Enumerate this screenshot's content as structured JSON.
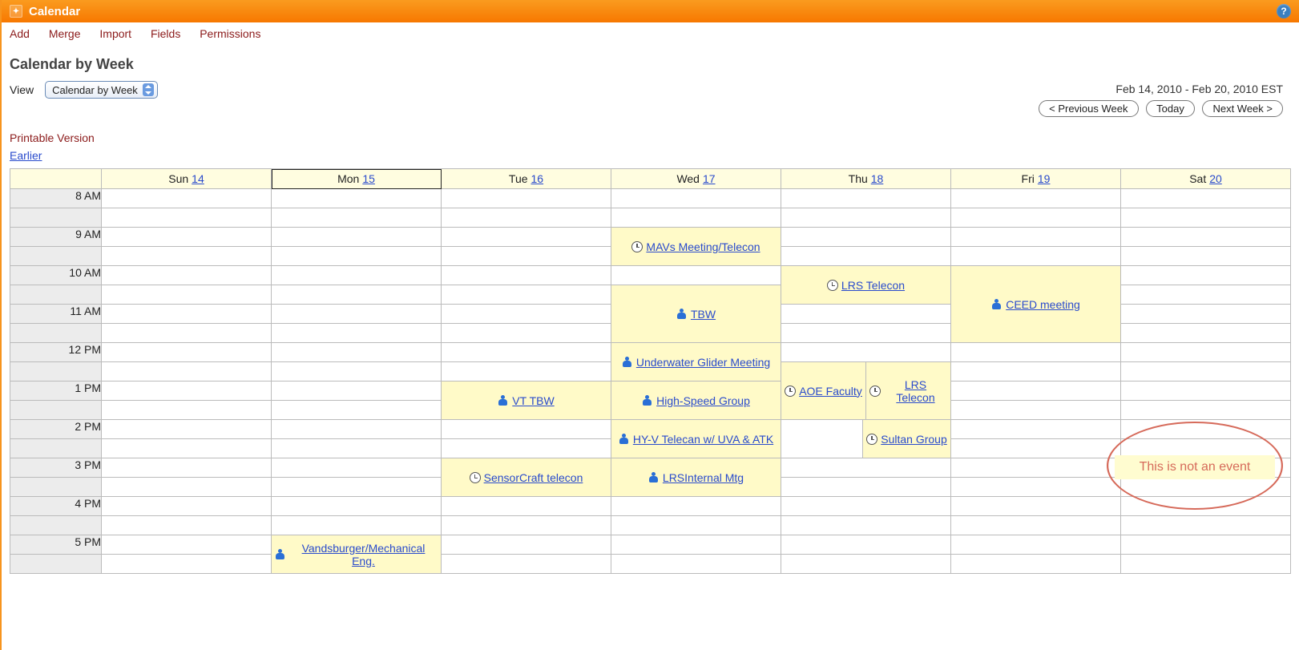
{
  "titlebar": {
    "label": "Calendar"
  },
  "menu": {
    "add": "Add",
    "merge": "Merge",
    "import": "Import",
    "fields": "Fields",
    "permissions": "Permissions"
  },
  "page_title": "Calendar by Week",
  "view": {
    "label": "View",
    "selected": "Calendar by Week"
  },
  "range": "Feb 14, 2010 - Feb 20, 2010 EST",
  "nav": {
    "prev": "< Previous Week",
    "today": "Today",
    "next": "Next Week >"
  },
  "printable": "Printable Version",
  "earlier": "Earlier",
  "days": [
    {
      "label": "Sun",
      "num": "14"
    },
    {
      "label": "Mon",
      "num": "15"
    },
    {
      "label": "Tue",
      "num": "16"
    },
    {
      "label": "Wed",
      "num": "17"
    },
    {
      "label": "Thu",
      "num": "18"
    },
    {
      "label": "Fri",
      "num": "19"
    },
    {
      "label": "Sat",
      "num": "20"
    }
  ],
  "hours": [
    "8 AM",
    "",
    "9 AM",
    "",
    "10 AM",
    "",
    "11 AM",
    "",
    "12 PM",
    "",
    "1 PM",
    "",
    "2 PM",
    "",
    "3 PM",
    "",
    "4 PM",
    "",
    "5 PM",
    ""
  ],
  "events": {
    "mon_5pm": "Vandsburger/Mechanical Eng.",
    "tue_1pm": "VT TBW",
    "tue_3pm": "SensorCraft telecon",
    "wed_9am": "MAVs Meeting/Telecon",
    "wed_1030": "TBW",
    "wed_12pm": "Underwater Glider Meeting",
    "wed_1pm": "High-Speed Group",
    "wed_2pm": "HY-V Telecan w/ UVA & ATK",
    "wed_3pm": "LRSInternal Mtg",
    "thu_10am": "LRS Telecon",
    "thu_1230a": "AOE Faculty",
    "thu_1pm": "LRS Telecon",
    "thu_2pm": "Sultan Group",
    "fri_10am": "CEED meeting"
  },
  "annotation": "This is not an event"
}
